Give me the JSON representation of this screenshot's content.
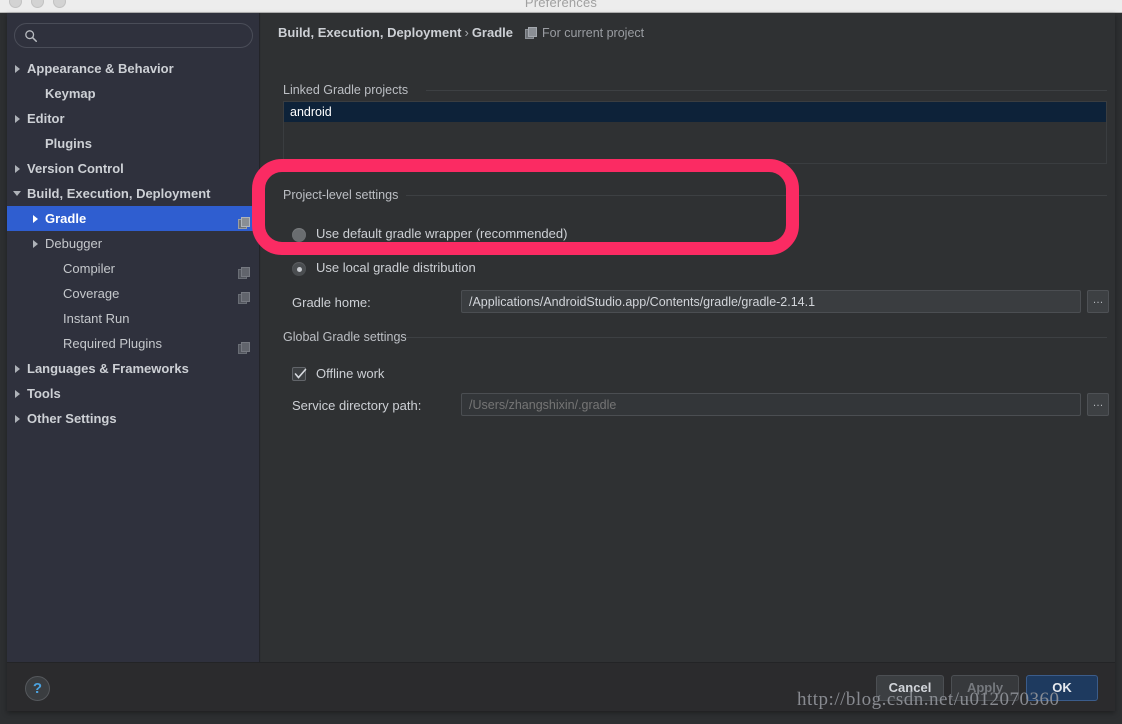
{
  "window": {
    "title": "Preferences",
    "traffic_lights": [
      "close",
      "minimize",
      "zoom"
    ]
  },
  "sidebar": {
    "search": {
      "value": "",
      "placeholder": ""
    },
    "items": [
      {
        "label": "Appearance & Behavior",
        "arrow": "right",
        "indent": 20,
        "bold": true,
        "selected": false,
        "icon": false
      },
      {
        "label": "Keymap",
        "arrow": "none",
        "indent": 38,
        "bold": true,
        "selected": false,
        "icon": false
      },
      {
        "label": "Editor",
        "arrow": "right",
        "indent": 20,
        "bold": true,
        "selected": false,
        "icon": false
      },
      {
        "label": "Plugins",
        "arrow": "none",
        "indent": 38,
        "bold": true,
        "selected": false,
        "icon": false
      },
      {
        "label": "Version Control",
        "arrow": "right",
        "indent": 20,
        "bold": true,
        "selected": false,
        "icon": false
      },
      {
        "label": "Build, Execution, Deployment",
        "arrow": "down",
        "indent": 20,
        "bold": true,
        "selected": false,
        "icon": false
      },
      {
        "label": "Gradle",
        "arrow": "right",
        "indent": 38,
        "bold": true,
        "selected": true,
        "icon": true
      },
      {
        "label": "Debugger",
        "arrow": "right",
        "indent": 38,
        "bold": false,
        "selected": false,
        "icon": false
      },
      {
        "label": "Compiler",
        "arrow": "none",
        "indent": 56,
        "bold": false,
        "selected": false,
        "icon": true
      },
      {
        "label": "Coverage",
        "arrow": "none",
        "indent": 56,
        "bold": false,
        "selected": false,
        "icon": true
      },
      {
        "label": "Instant Run",
        "arrow": "none",
        "indent": 56,
        "bold": false,
        "selected": false,
        "icon": false
      },
      {
        "label": "Required Plugins",
        "arrow": "none",
        "indent": 56,
        "bold": false,
        "selected": false,
        "icon": true
      },
      {
        "label": "Languages & Frameworks",
        "arrow": "right",
        "indent": 20,
        "bold": true,
        "selected": false,
        "icon": false
      },
      {
        "label": "Tools",
        "arrow": "right",
        "indent": 20,
        "bold": true,
        "selected": false,
        "icon": false
      },
      {
        "label": "Other Settings",
        "arrow": "right",
        "indent": 20,
        "bold": true,
        "selected": false,
        "icon": false
      }
    ]
  },
  "breadcrumb": {
    "parent": "Build, Execution, Deployment",
    "separator": "›",
    "current": "Gradle",
    "scope": "For current project"
  },
  "main": {
    "linked_projects": {
      "section_title": "Linked Gradle projects",
      "items": [
        {
          "label": "android",
          "selected": true
        }
      ]
    },
    "project_level": {
      "section_title": "Project-level settings",
      "use_wrapper": {
        "label": "Use default gradle wrapper (recommended)",
        "checked": false
      },
      "use_local": {
        "label": "Use local gradle distribution",
        "checked": true
      },
      "gradle_home": {
        "label": "Gradle home:",
        "value": "/Applications/AndroidStudio.app/Contents/gradle/gradle-2.14.1",
        "browse_label": "…"
      }
    },
    "global_settings": {
      "section_title": "Global Gradle settings",
      "offline_work": {
        "label": "Offline work",
        "checked": true
      },
      "service_dir": {
        "label": "Service directory path:",
        "value": "",
        "placeholder": "/Users/zhangshixin/.gradle",
        "browse_label": "…"
      }
    }
  },
  "annotation": {
    "highlight_color": "#fb2b63",
    "target": "Use default gradle wrapper (recommended)"
  },
  "footer": {
    "help_label": "?",
    "cancel_label": "Cancel",
    "apply_label": "Apply",
    "apply_disabled": true,
    "ok_label": "OK"
  },
  "watermark": {
    "text": "http://blog.csdn.net/u012070360"
  }
}
